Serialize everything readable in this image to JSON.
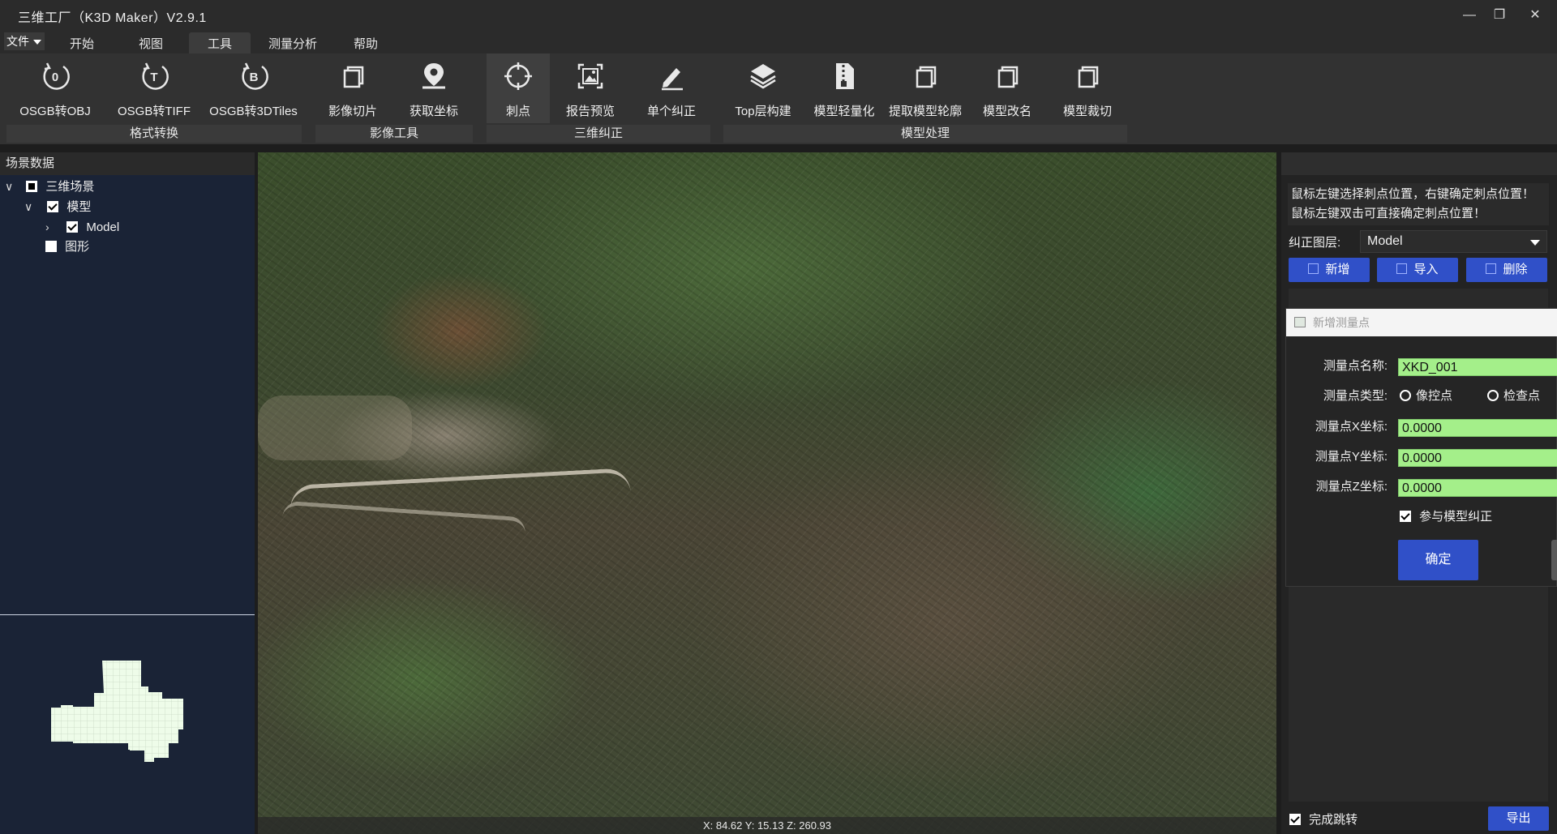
{
  "app": {
    "title": "三维工厂（K3D Maker）V2.9.1",
    "window_buttons": {
      "minimize": "—",
      "restore": "❐",
      "close": "✕"
    }
  },
  "menu": {
    "file_label": "文件",
    "tabs": [
      {
        "label": "开始"
      },
      {
        "label": "视图"
      },
      {
        "label": "工具",
        "active": true
      },
      {
        "label": "测量分析"
      },
      {
        "label": "帮助"
      }
    ]
  },
  "ribbon": {
    "buttons": [
      {
        "label": "OSGB转OBJ",
        "icon": "osgb-obj-icon"
      },
      {
        "label": "OSGB转TIFF",
        "icon": "osgb-tiff-icon"
      },
      {
        "label": "OSGB转3DTiles",
        "icon": "osgb-3dtiles-icon"
      },
      {
        "label": "影像切片",
        "icon": "image-slice-icon"
      },
      {
        "label": "获取坐标",
        "icon": "location-pin-icon"
      },
      {
        "label": "刺点",
        "icon": "crosshair-icon",
        "selected": true
      },
      {
        "label": "报告预览",
        "icon": "report-preview-icon"
      },
      {
        "label": "单个纠正",
        "icon": "pen-edit-icon"
      },
      {
        "label": "Top层构建",
        "icon": "layers-icon"
      },
      {
        "label": "模型轻量化",
        "icon": "zip-file-icon"
      },
      {
        "label": "提取模型轮廓",
        "icon": "copy-icon"
      },
      {
        "label": "模型改名",
        "icon": "copy-icon"
      },
      {
        "label": "模型裁切",
        "icon": "copy-icon"
      }
    ],
    "groups": [
      {
        "label": "格式转换"
      },
      {
        "label": "影像工具"
      },
      {
        "label": "三维纠正"
      },
      {
        "label": "模型处理"
      }
    ]
  },
  "left_panel": {
    "header": "场景数据",
    "tree": [
      {
        "label": "三维场景",
        "expanded": true,
        "check": "partial"
      },
      {
        "label": "模型",
        "expanded": true,
        "check": "checked"
      },
      {
        "label": "Model",
        "expanded": false,
        "check": "checked"
      },
      {
        "label": "图形",
        "check": "unchecked"
      }
    ]
  },
  "viewport": {
    "coords": "X: 84.62  Y: 15.13  Z: 260.93"
  },
  "right_panel": {
    "hint": "鼠标左键选择刺点位置，右键确定刺点位置！鼠标左键双击可直接确定刺点位置！",
    "layer_label": "纠正图层:",
    "layer_value": "Model",
    "add_label": "新增",
    "import_label": "导入",
    "delete_label": "删除",
    "finish_jump_label": "完成跳转",
    "export_label": "导出"
  },
  "dialog": {
    "title": "新增测量点",
    "name_label": "测量点名称:",
    "name_value": "XKD_001",
    "type_label": "测量点类型:",
    "type_opt1": "像控点",
    "type_opt2": "检查点",
    "x_label": "测量点X坐标:",
    "x_value": "0.0000",
    "y_label": "测量点Y坐标:",
    "y_value": "0.0000",
    "z_label": "测量点Z坐标:",
    "z_value": "0.0000",
    "participate_label": "参与模型纠正",
    "ok_label": "确定"
  },
  "colors": {
    "accent_blue": "#3050c8",
    "input_green": "#a4ef8a",
    "left_panel_bg": "#1a2336",
    "minimap_fill": "#eefce9"
  }
}
